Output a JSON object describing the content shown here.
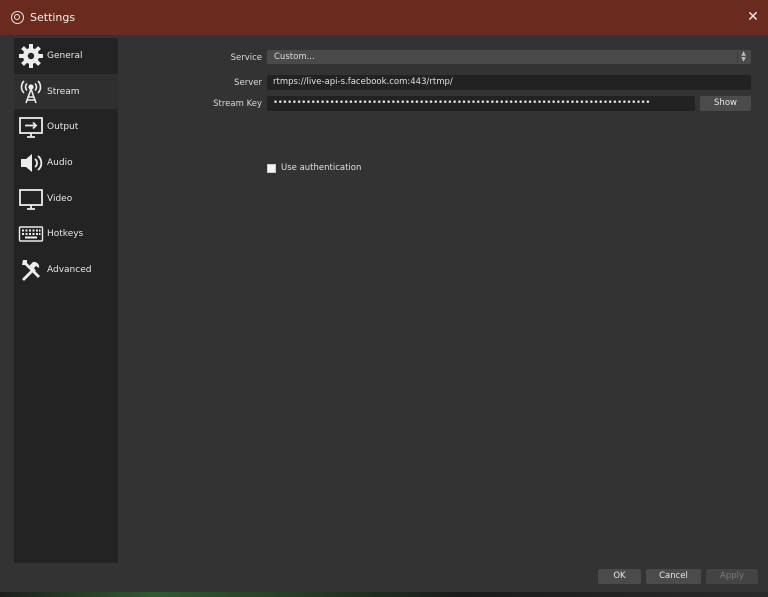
{
  "window": {
    "title": "Settings",
    "close_glyph": "✕"
  },
  "sidebar": {
    "items": [
      {
        "label": "General",
        "icon": "gear-icon"
      },
      {
        "label": "Stream",
        "icon": "antenna-icon",
        "active": true
      },
      {
        "label": "Output",
        "icon": "output-icon"
      },
      {
        "label": "Audio",
        "icon": "speaker-icon"
      },
      {
        "label": "Video",
        "icon": "monitor-icon"
      },
      {
        "label": "Hotkeys",
        "icon": "keyboard-icon"
      },
      {
        "label": "Advanced",
        "icon": "tools-icon"
      }
    ]
  },
  "stream": {
    "service_label": "Service",
    "service_value": "Custom...",
    "server_label": "Server",
    "server_value": "rtmps://live-api-s.facebook.com:443/rtmp/",
    "key_label": "Stream Key",
    "key_value": "••••••••••••••••••••••••••••••••••••••••••••••••••••••••••••••••••••••••••••••••",
    "show_button": "Show",
    "auth_label": "Use authentication",
    "auth_checked": false
  },
  "footer": {
    "ok": "OK",
    "cancel": "Cancel",
    "apply": "Apply"
  },
  "colors": {
    "titlebar": "#6b2a1e",
    "panel": "#333333",
    "sidebar": "#232323"
  }
}
